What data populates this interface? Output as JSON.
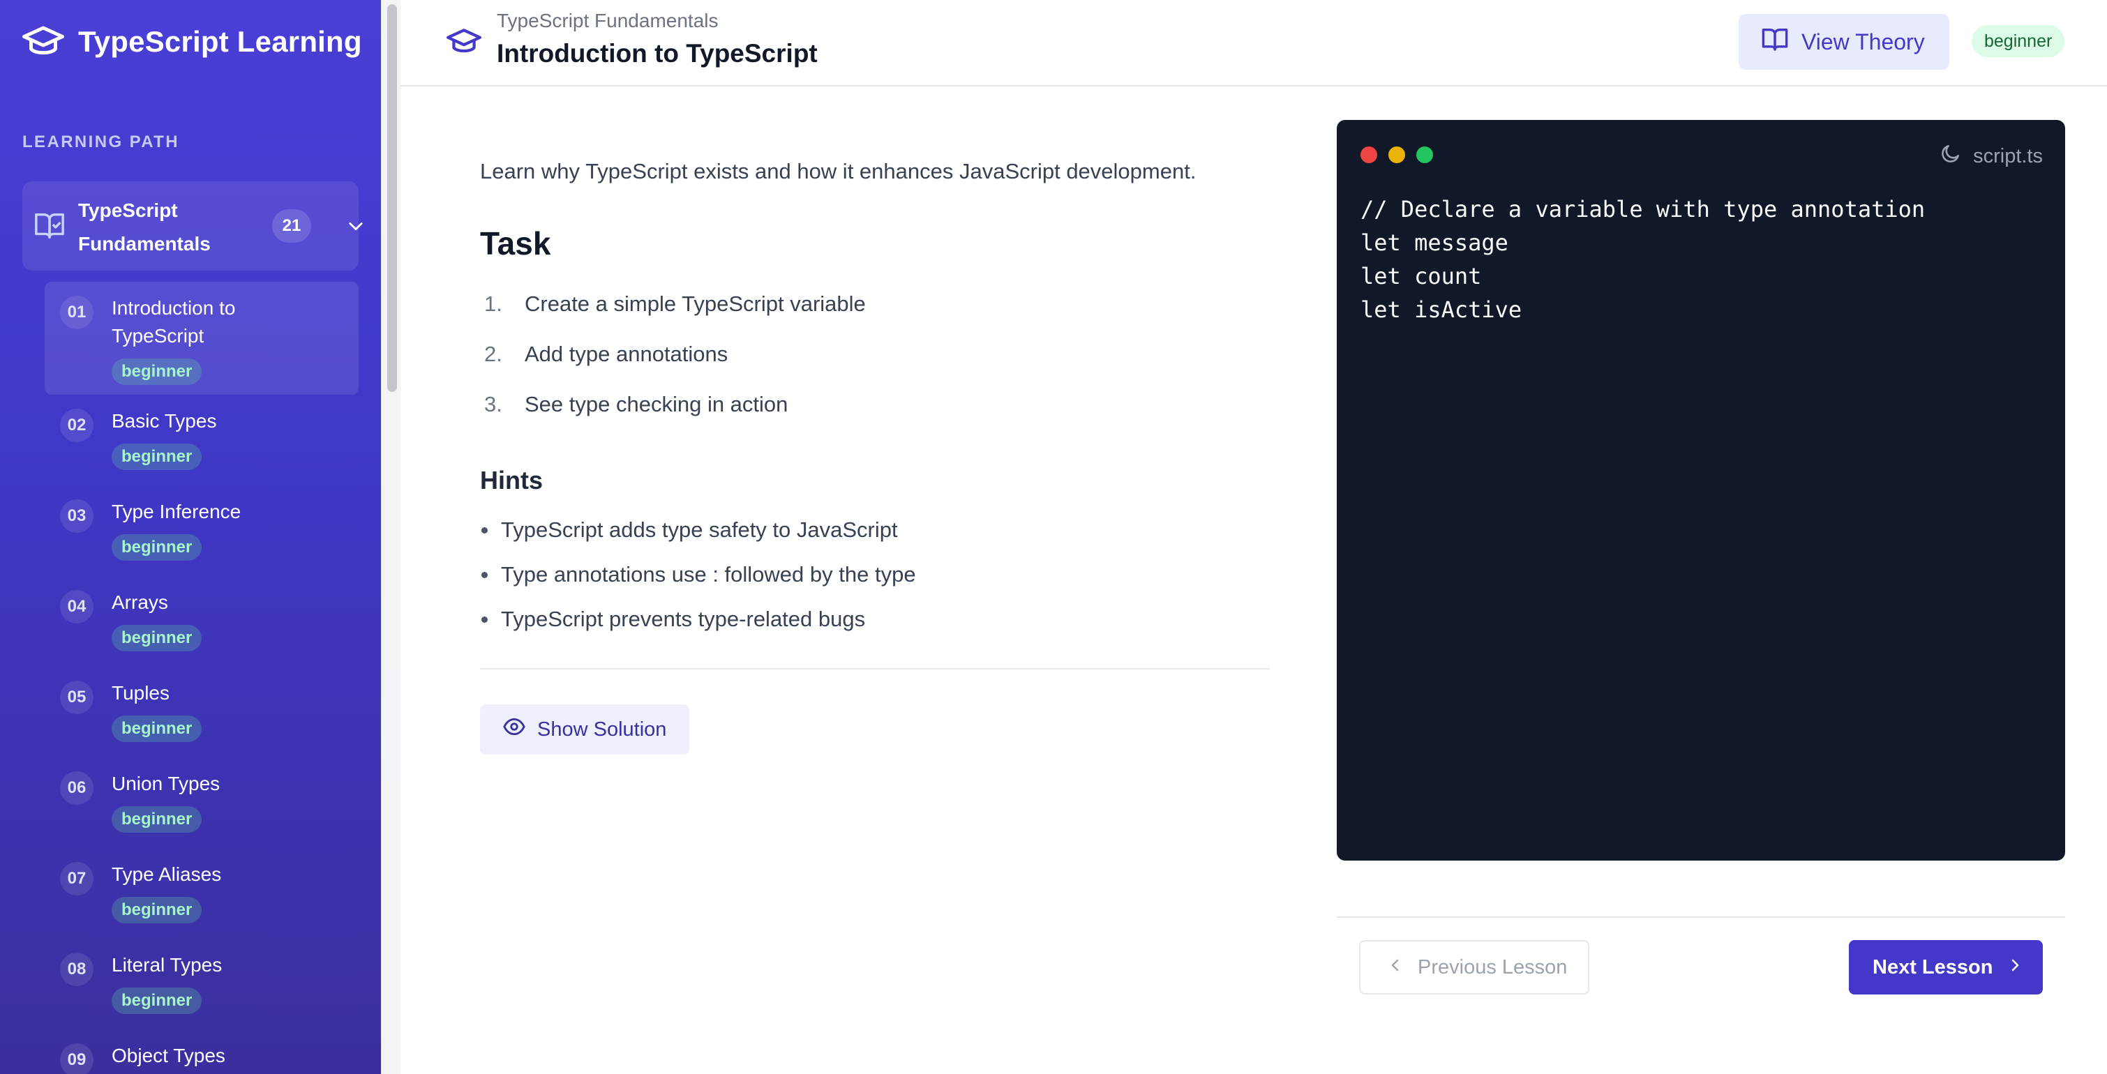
{
  "app": {
    "title": "TypeScript Learning",
    "accent_color": "#4338ca",
    "sidebar_color": "#4a3fd6"
  },
  "sidebar": {
    "section_label": "LEARNING PATH",
    "course": {
      "title": "TypeScript Fundamentals",
      "lesson_count": "21",
      "icon": "book-icon"
    },
    "lessons": [
      {
        "number": "01",
        "title": "Introduction to TypeScript",
        "level": "beginner",
        "active": true
      },
      {
        "number": "02",
        "title": "Basic Types",
        "level": "beginner"
      },
      {
        "number": "03",
        "title": "Type Inference",
        "level": "beginner"
      },
      {
        "number": "04",
        "title": "Arrays",
        "level": "beginner"
      },
      {
        "number": "05",
        "title": "Tuples",
        "level": "beginner"
      },
      {
        "number": "06",
        "title": "Union Types",
        "level": "beginner"
      },
      {
        "number": "07",
        "title": "Type Aliases",
        "level": "beginner"
      },
      {
        "number": "08",
        "title": "Literal Types",
        "level": "beginner"
      },
      {
        "number": "09",
        "title": "Object Types",
        "level": ""
      }
    ]
  },
  "header": {
    "breadcrumb": "TypeScript Fundamentals",
    "title": "Introduction to TypeScript",
    "view_theory_label": "View Theory",
    "level": "beginner"
  },
  "lesson": {
    "description": "Learn why TypeScript exists and how it enhances JavaScript development.",
    "task_heading": "Task",
    "tasks": [
      {
        "number": "1.",
        "text": "Create a simple TypeScript variable"
      },
      {
        "number": "2.",
        "text": "Add type annotations"
      },
      {
        "number": "3.",
        "text": "See type checking in action"
      }
    ],
    "hints_heading": "Hints",
    "hints": [
      "TypeScript adds type safety to JavaScript",
      "Type annotations use : followed by the type",
      "TypeScript prevents type-related bugs"
    ],
    "show_solution_label": "Show Solution"
  },
  "editor": {
    "filename": "script.ts",
    "code_lines": [
      "// Declare a variable with type annotation",
      "let message",
      "let count",
      "let isActive"
    ]
  },
  "navigation": {
    "previous_label": "Previous Lesson",
    "next_label": "Next Lesson"
  }
}
